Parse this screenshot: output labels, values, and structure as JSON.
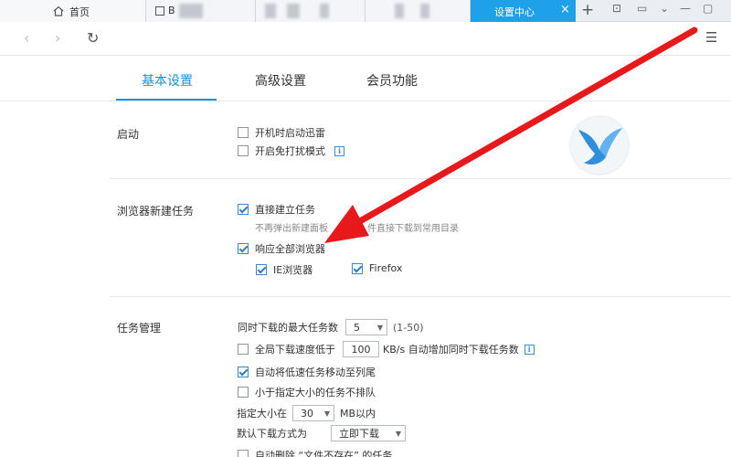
{
  "browser": {
    "tabs": {
      "home": "首页",
      "second": "B",
      "active": "设置中心",
      "new_tab": "+",
      "close": "×"
    },
    "nav": {
      "back": "‹",
      "forward": "›",
      "refresh": "↻",
      "menu": "☰"
    }
  },
  "settings_tabs": [
    {
      "label": "基本设置",
      "active": true
    },
    {
      "label": "高级设置",
      "active": false
    },
    {
      "label": "会员功能",
      "active": false
    }
  ],
  "sections": {
    "startup": {
      "title": "启动",
      "options": [
        {
          "label": "开机时启动迅雷",
          "checked": false
        },
        {
          "label": "开启免打扰模式",
          "checked": false
        }
      ]
    },
    "browser_task": {
      "title": "浏览器新建任务",
      "direct": {
        "label": "直接建立任务",
        "checked": true,
        "hint": "不再弹出新建面板",
        "hint2": "件直接下载到常用目录"
      },
      "respond_all": {
        "label": "响应全部浏览器",
        "checked": true
      },
      "ie": {
        "label": "IE浏览器",
        "checked": true
      },
      "firefox": {
        "label": "Firefox",
        "checked": true
      }
    },
    "task_mgmt": {
      "title": "任务管理",
      "max_tasks_label": "同时下载的最大任务数",
      "max_tasks_value": "5",
      "max_tasks_range": "(1-50)",
      "global_speed": {
        "label": "全局下载速度低于",
        "checked": false,
        "value": "100",
        "suffix": "KB/s 自动增加同时下载任务数"
      },
      "auto_move": {
        "label": "自动将低速任务移动至列尾",
        "checked": true
      },
      "small_task": {
        "label": "小于指定大小的任务不排队",
        "checked": false
      },
      "size_label": "指定大小在",
      "size_value": "30",
      "size_unit": "MB以内",
      "default_mode_label": "默认下载方式为",
      "default_mode_value": "立即下载",
      "auto_delete": {
        "label": "自动删除 “文件不存在” 的任务",
        "checked": false
      }
    }
  },
  "colors": {
    "accent": "#1a8fe0",
    "active_tab": "#1fa1ea",
    "arrow": "#e8191b"
  },
  "icons": {
    "home": "home-icon",
    "info": "info-icon",
    "logo": "xunlei-bird-logo"
  }
}
